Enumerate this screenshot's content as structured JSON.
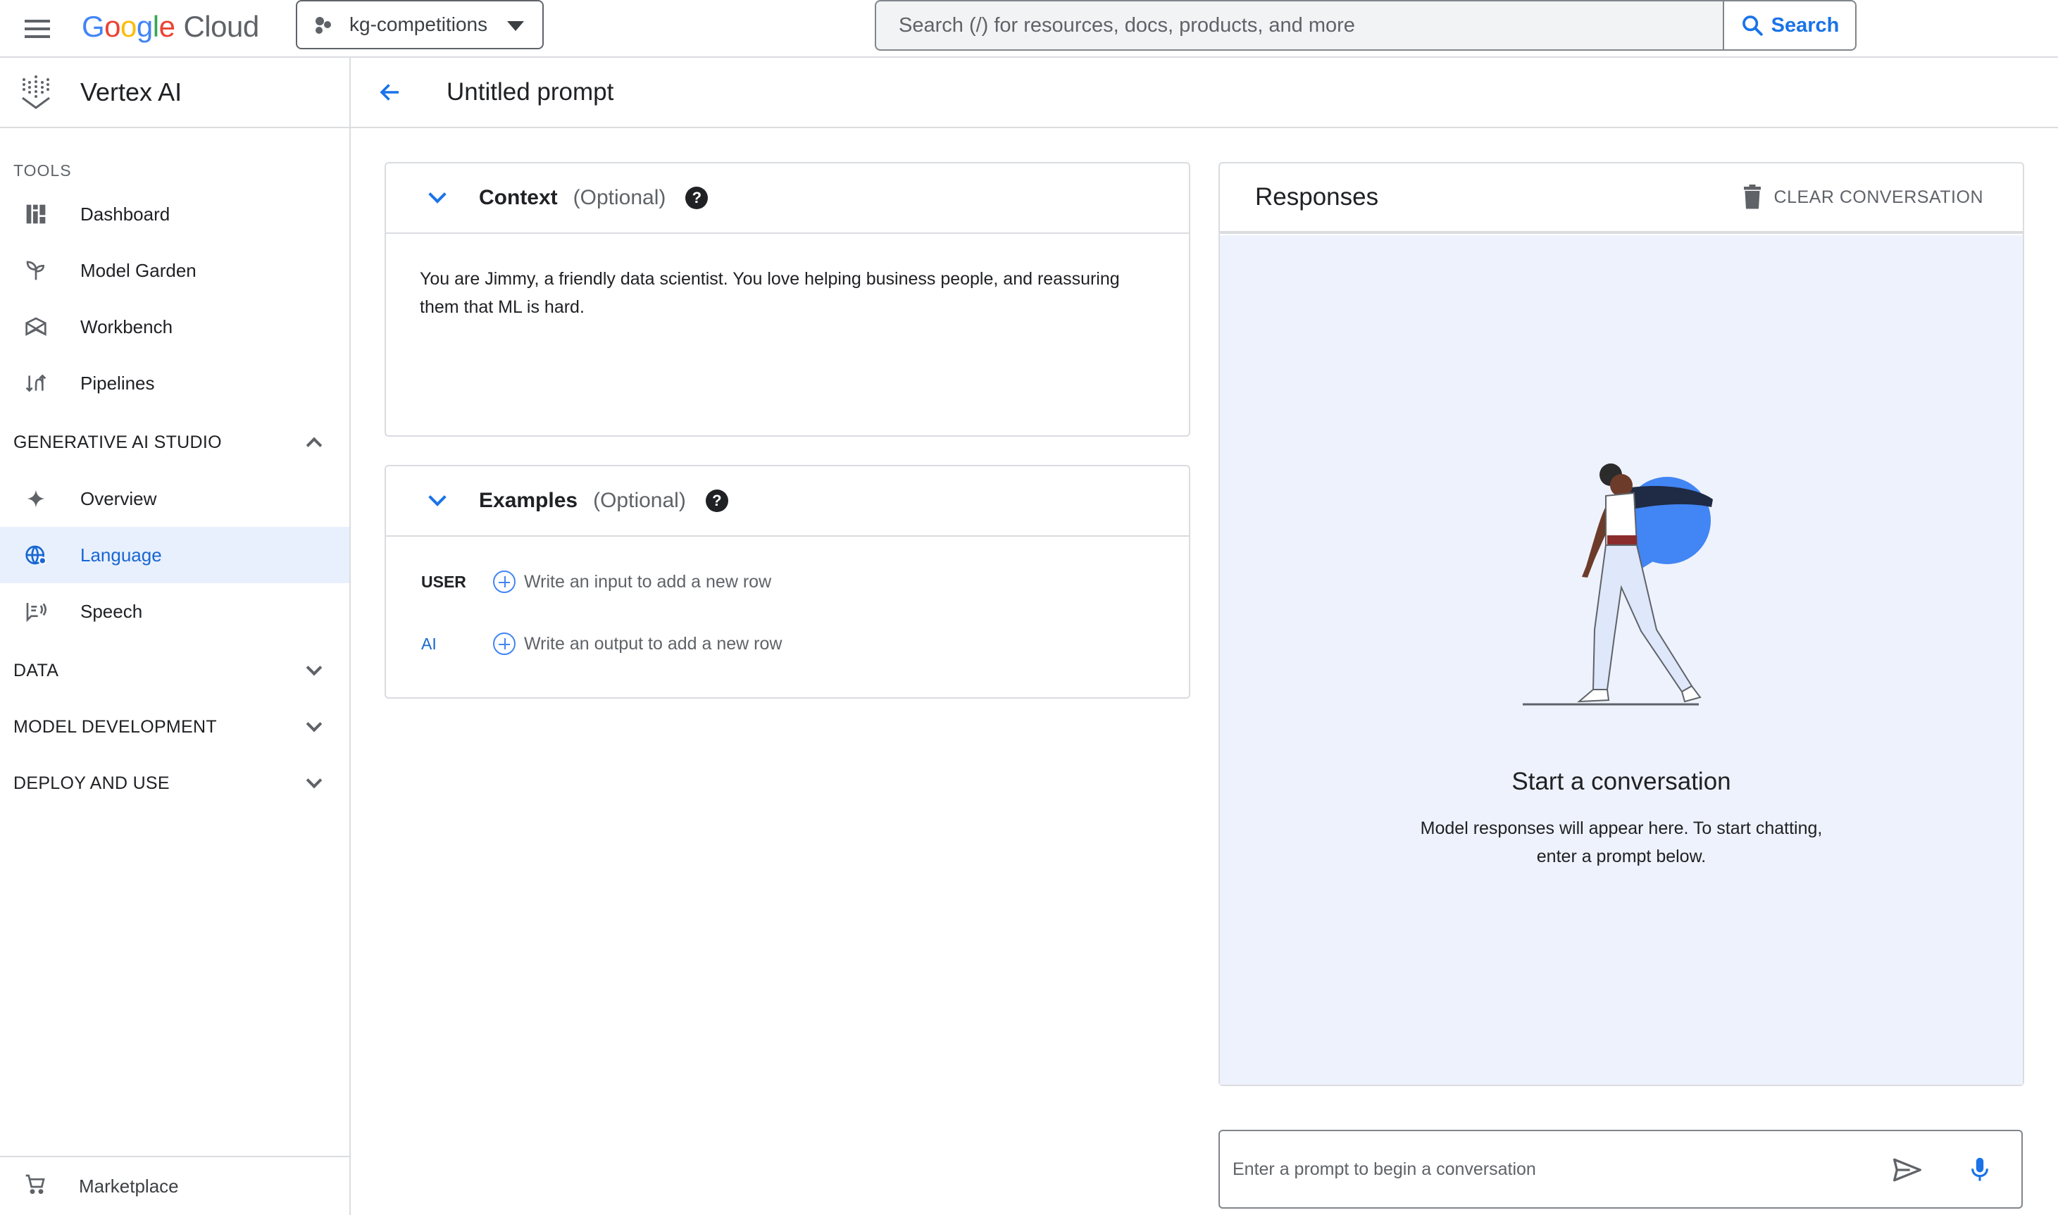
{
  "topbar": {
    "logo_letters": [
      "G",
      "o",
      "o",
      "g",
      "l",
      "e"
    ],
    "logo_product": "Cloud",
    "project": "kg-competitions",
    "search_placeholder": "Search (/) for resources, docs, products, and more",
    "search_button": "Search"
  },
  "sidebar": {
    "product_title": "Vertex AI",
    "tools_label": "TOOLS",
    "tools": [
      {
        "label": "Dashboard",
        "icon": "dashboard-icon"
      },
      {
        "label": "Model Garden",
        "icon": "model-garden-icon"
      },
      {
        "label": "Workbench",
        "icon": "workbench-icon"
      },
      {
        "label": "Pipelines",
        "icon": "pipelines-icon"
      }
    ],
    "gen_ai_label": "GENERATIVE AI STUDIO",
    "gen_ai_items": [
      {
        "label": "Overview",
        "icon": "sparkle-icon"
      },
      {
        "label": "Language",
        "icon": "language-icon",
        "active": true
      },
      {
        "label": "Speech",
        "icon": "speech-icon"
      }
    ],
    "groups": [
      "DATA",
      "MODEL DEVELOPMENT",
      "DEPLOY AND USE"
    ],
    "footer": "Marketplace"
  },
  "page": {
    "title": "Untitled prompt"
  },
  "context": {
    "title": "Context",
    "optional": "(Optional)",
    "text": "You are Jimmy, a friendly data scientist. You love helping business people, and reassuring them that ML is hard."
  },
  "examples": {
    "title": "Examples",
    "optional": "(Optional)",
    "user_label": "USER",
    "user_add": "Write an input to add a new row",
    "ai_label": "AI",
    "ai_add": "Write an output to add a new row"
  },
  "responses": {
    "title": "Responses",
    "clear": "CLEAR CONVERSATION",
    "empty_title": "Start a conversation",
    "empty_desc": "Model responses will appear here. To start chatting, enter a prompt below."
  },
  "prompt": {
    "placeholder": "Enter a prompt to begin a conversation"
  },
  "colors": {
    "accent": "#1a73e8",
    "active_bg": "#e8f0fe",
    "response_bg": "#eef2fc"
  }
}
